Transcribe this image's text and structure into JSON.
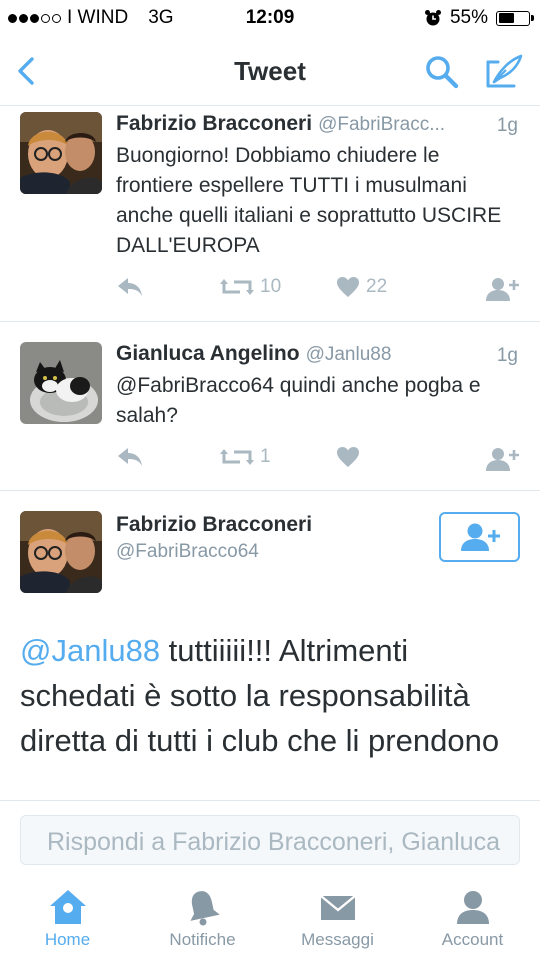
{
  "status_bar": {
    "carrier": "I WIND",
    "network": "3G",
    "time": "12:09",
    "battery": "55%",
    "battery_level": 0.55,
    "signal_filled": 3,
    "signal_total": 5
  },
  "nav": {
    "title": "Tweet",
    "back_icon": "chevron-left-icon",
    "search_icon": "search-icon",
    "compose_icon": "compose-icon"
  },
  "tweets": [
    {
      "name": "Fabrizio Bracconeri",
      "handle": "@FabriBracc...",
      "time": "1g",
      "text": "Buongiorno! Dobbiamo chiudere le frontiere espellere TUTTI i musulmani anche quelli italiani e soprattutto USCIRE DALL'EUROPA",
      "retweets": "10",
      "likes": "22"
    },
    {
      "name": "Gianluca Angelino",
      "handle": "@Janlu88",
      "time": "1g",
      "text": "@FabriBracco64 quindi anche pogba e salah?",
      "retweets": "1",
      "likes": ""
    }
  ],
  "main_tweet": {
    "name": "Fabrizio Bracconeri",
    "handle": "@FabriBracco64",
    "mention": "@Janlu88",
    "text": " tuttiiiii!!! Altrimenti schedati è sotto la responsabilità diretta di tutti i club che li prendono"
  },
  "reply": {
    "placeholder": "Rispondi a Fabrizio Bracconeri, Gianluca"
  },
  "tabs": [
    {
      "label": "Home",
      "icon": "home-icon"
    },
    {
      "label": "Notifiche",
      "icon": "bell-icon"
    },
    {
      "label": "Messaggi",
      "icon": "envelope-icon"
    },
    {
      "label": "Account",
      "icon": "person-icon"
    }
  ],
  "colors": {
    "accent": "#55acee",
    "muted": "#aab8c2",
    "text": "#292f33"
  }
}
